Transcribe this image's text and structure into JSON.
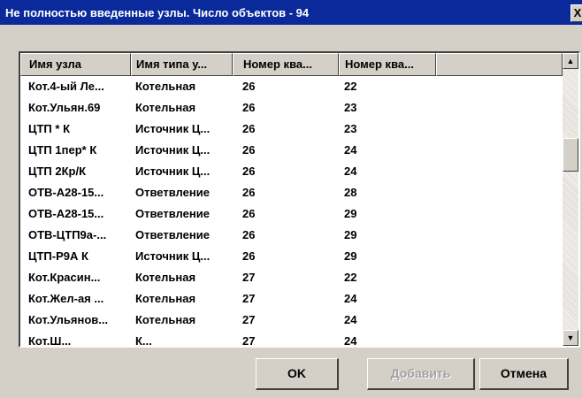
{
  "window": {
    "title": "Не полностью введенные узлы. Число объектов - 94",
    "close_glyph": "X"
  },
  "table": {
    "columns": [
      "Имя узла",
      "Имя типа у...",
      "Номер ква...",
      "Номер ква..."
    ],
    "rows": [
      [
        "Кот.4-ый Ле...",
        "Котельная",
        "26",
        "22"
      ],
      [
        "Кот.Ульян.69",
        "Котельная",
        "26",
        "23"
      ],
      [
        "ЦТП * К",
        "Источник Ц...",
        "26",
        "23"
      ],
      [
        "ЦТП 1пер* К",
        "Источник Ц...",
        "26",
        "24"
      ],
      [
        "ЦТП 2Кр/К",
        "Источник Ц...",
        "26",
        "24"
      ],
      [
        "ОТВ-А28-15...",
        "Ответвление",
        "26",
        "28"
      ],
      [
        "ОТВ-А28-15...",
        "Ответвление",
        "26",
        "29"
      ],
      [
        "ОТВ-ЦТП9а-...",
        "Ответвление",
        "26",
        "29"
      ],
      [
        "ЦТП-Р9А К",
        "Источник Ц...",
        "26",
        "29"
      ],
      [
        "Кот.Красин...",
        "Котельная",
        "27",
        "22"
      ],
      [
        "Кот.Жел-ая ...",
        "Котельная",
        "27",
        "24"
      ],
      [
        "Кот.Ульянов...",
        "Котельная",
        "27",
        "24"
      ],
      [
        "Кот.Ш...",
        "К...",
        "27",
        "24"
      ]
    ]
  },
  "buttons": {
    "ok": "OK",
    "add": "Добавить",
    "cancel": "Отмена"
  },
  "colors": {
    "titlebar": "#0a2a9c",
    "face": "#d4d0c8",
    "list_bg": "#ffffff",
    "disabled_text": "#a0a0a0"
  }
}
